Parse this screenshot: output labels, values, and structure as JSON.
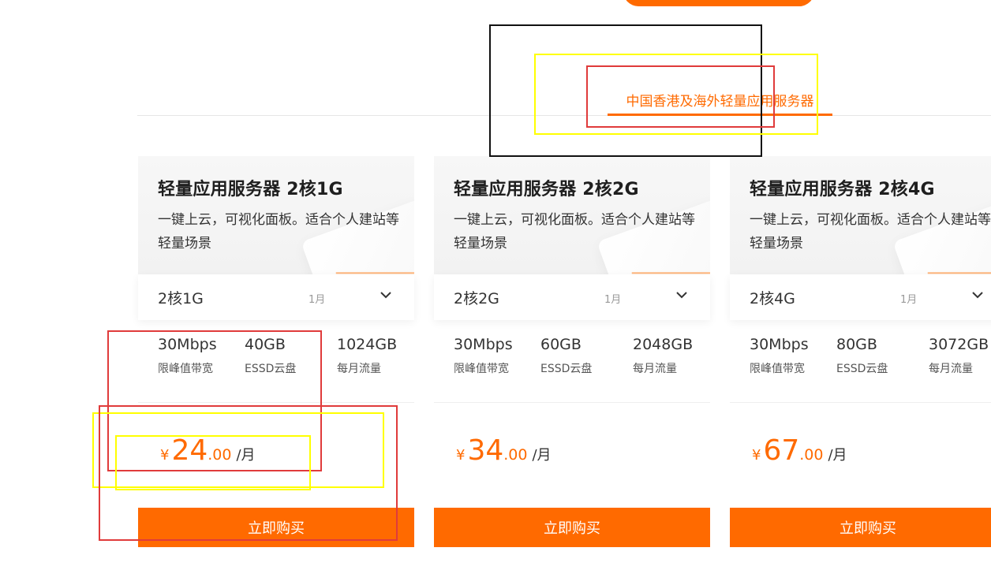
{
  "colors": {
    "accent": "#ff6a00",
    "overlay_black": "#111111",
    "overlay_yellow": "#ffff00",
    "overlay_red": "#e03b3b"
  },
  "tabs": [
    {
      "label": "中国香港及海外轻量应用服务器",
      "active": true
    }
  ],
  "cards": [
    {
      "title": "轻量应用服务器 2核1G",
      "description": "一键上云，可视化面板。适合个人建站等轻量场景",
      "selector": {
        "value": "2核1G",
        "period": "1月"
      },
      "specs": [
        {
          "value": "30Mbps",
          "label": "限峰值带宽"
        },
        {
          "value": "40GB",
          "label": "ESSD云盘"
        },
        {
          "value": "1024GB",
          "label": "每月流量"
        }
      ],
      "price": {
        "currency": "¥",
        "integer": "24",
        "decimal": ".00",
        "unit": "/月"
      },
      "buy_label": "立即购买"
    },
    {
      "title": "轻量应用服务器 2核2G",
      "description": "一键上云，可视化面板。适合个人建站等轻量场景",
      "selector": {
        "value": "2核2G",
        "period": "1月"
      },
      "specs": [
        {
          "value": "30Mbps",
          "label": "限峰值带宽"
        },
        {
          "value": "60GB",
          "label": "ESSD云盘"
        },
        {
          "value": "2048GB",
          "label": "每月流量"
        }
      ],
      "price": {
        "currency": "¥",
        "integer": "34",
        "decimal": ".00",
        "unit": "/月"
      },
      "buy_label": "立即购买"
    },
    {
      "title": "轻量应用服务器 2核4G",
      "description": "一键上云，可视化面板。适合个人建站等轻量场景",
      "selector": {
        "value": "2核4G",
        "period": "1月"
      },
      "specs": [
        {
          "value": "30Mbps",
          "label": "限峰值带宽"
        },
        {
          "value": "80GB",
          "label": "ESSD云盘"
        },
        {
          "value": "3072GB",
          "label": "每月流量"
        }
      ],
      "price": {
        "currency": "¥",
        "integer": "67",
        "decimal": ".00",
        "unit": "/月"
      },
      "buy_label": "立即购买"
    }
  ]
}
